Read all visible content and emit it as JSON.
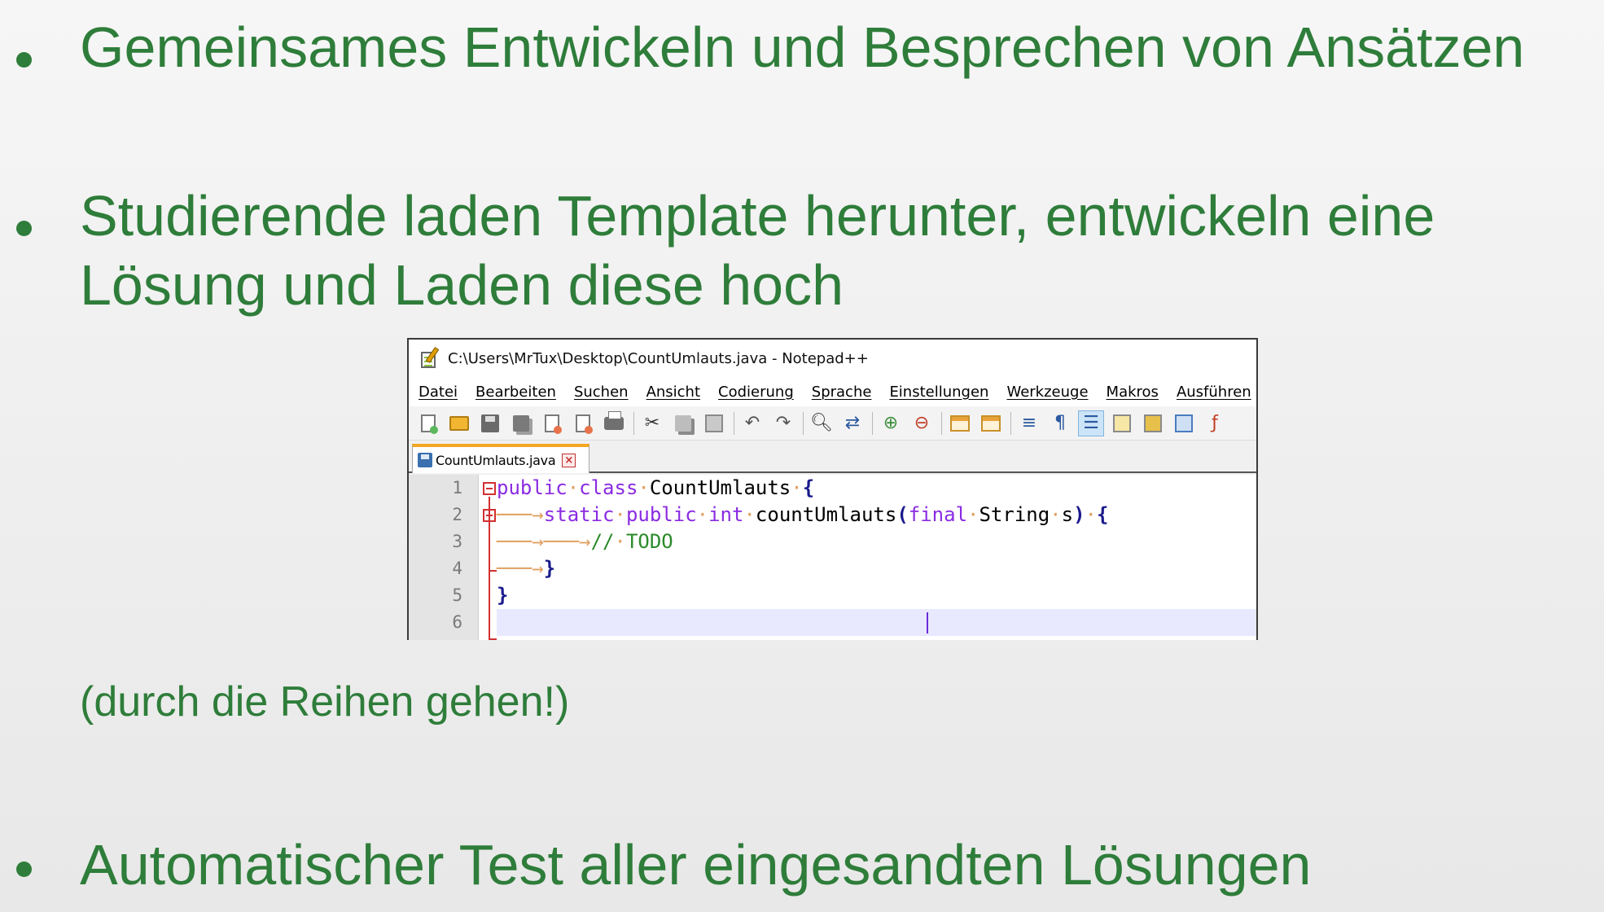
{
  "slide": {
    "bullets": [
      {
        "text": "Gemeinsames Entwickeln und Besprechen von Ansätzen"
      },
      {
        "line1": "Studierende laden Template herunter, entwickeln eine",
        "line2": "Lösung und Laden diese hoch"
      },
      {
        "text": "Automatischer Test aller eingesandten Lösungen"
      }
    ],
    "note": "(durch die Reihen gehen!)",
    "colors": {
      "text": "#2e7d3a",
      "background": "#f0f0f0"
    }
  },
  "editor_window": {
    "title": "C:\\Users\\MrTux\\Desktop\\CountUmlauts.java - Notepad++",
    "menu": [
      "Datei",
      "Bearbeiten",
      "Suchen",
      "Ansicht",
      "Codierung",
      "Sprache",
      "Einstellungen",
      "Werkzeuge",
      "Makros",
      "Ausführen"
    ],
    "toolbar_icons": [
      "new-file-icon",
      "open-file-icon",
      "save-icon",
      "save-all-icon",
      "close-icon",
      "close-all-icon",
      "print-icon",
      "cut-icon",
      "copy-icon",
      "paste-icon",
      "undo-icon",
      "redo-icon",
      "find-icon",
      "replace-icon",
      "zoom-in-icon",
      "zoom-out-icon",
      "sync-vertical-icon",
      "sync-horizontal-icon",
      "word-wrap-icon",
      "show-all-chars-icon",
      "indent-guide-icon",
      "user-language-icon",
      "doc-map-icon",
      "function-list-icon",
      "monitoring-icon"
    ],
    "tab": {
      "label": "CountUmlauts.java"
    },
    "line_numbers": [
      "1",
      "2",
      "3",
      "4",
      "5",
      "6"
    ],
    "code": {
      "l1_kw1": "public",
      "l1_kw2": "class",
      "l1_name": "CountUmlauts",
      "l1_brace": "{",
      "l2_kw1": "static",
      "l2_kw2": "public",
      "l2_kw3": "int",
      "l2_method": "countUmlauts",
      "l2_paren_open": "(",
      "l2_kw4": "final",
      "l2_type": "String",
      "l2_param": "s",
      "l2_paren_close": ")",
      "l2_brace": "{",
      "l3_comment": "//",
      "l3_todo": "TODO",
      "l4_brace": "}",
      "l5_brace": "}"
    }
  }
}
